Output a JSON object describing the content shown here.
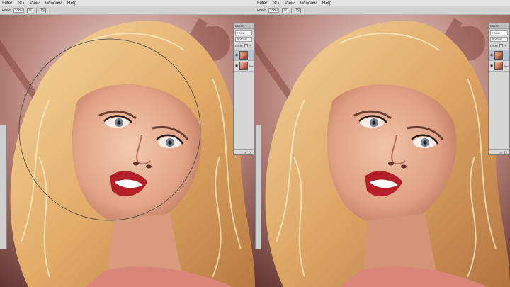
{
  "menu": [
    "Filter",
    "3D",
    "View",
    "Window",
    "Help"
  ],
  "options_bar": {
    "zoom_label": "Flow:",
    "zoom_value": "100%"
  },
  "layers_panel": {
    "tab": "Layers",
    "search_placeholder": "Kind",
    "blend_mode": "Normal",
    "lock_label": "Lock:",
    "layers": [
      {
        "name": "",
        "visible": true,
        "selected": false
      },
      {
        "name": "Bac",
        "visible": true,
        "selected": false
      }
    ],
    "footer_buttons": [
      "fx",
      "mask"
    ]
  },
  "colors": {
    "menubar": "#e3e3e3",
    "panel": "#d6d6d6",
    "hair": "#e8b97b",
    "skin": "#e9b39a",
    "lips": "#b3202a",
    "background_bokeh": "#8a4c44"
  },
  "icons": {
    "eye": "eye-icon",
    "brush": "brush-icon",
    "lock": "lock-icon"
  }
}
